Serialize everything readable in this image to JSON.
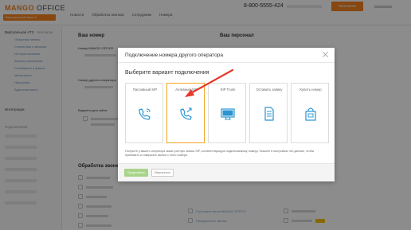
{
  "app": {
    "logo_brand": "MANGO",
    "logo_suffix": " OFFICE",
    "account": "Виртуальный офис ▾",
    "nav": [
      "Новости",
      "Обработка звонков",
      "Сотрудники",
      "Номера"
    ],
    "phone": "8-800-5555-424",
    "pay_label": "Пополнить"
  },
  "sidebar": {
    "section_main": "Виртуальная АТС",
    "section_main_secondary": "Контакты",
    "sub_items": [
      "Обзорная панель",
      "Статистика и звонков",
      "История вызовов",
      "Записи разговоров",
      "Сообщения и факсы",
      "Мониторинг",
      "Настройки",
      "Адресная книга"
    ],
    "integrations": "Интеграции",
    "connections_head": "Подключение"
  },
  "content": {
    "your_number": "Ваш номер",
    "mango_office_number": "Номер MANGO OFFICE",
    "other_operator_number": "Номер другого оператора",
    "site_widget": "Виджеты для сайта",
    "your_staff": "Ваш персонал",
    "call_processing": "Обработка звонков",
    "mango_office_voice": "Голосовое меню MANGO OFFICE",
    "holiday_routing": "Праздничные звонки"
  },
  "modal": {
    "title": "Подключение номера другого оператора",
    "subtitle": "Выберите вариант подключения",
    "options": [
      {
        "label": "Пассивный SIP",
        "icon": "phone-sip-icon"
      },
      {
        "label": "Активный SIP",
        "icon": "phone-active-sip-icon"
      },
      {
        "label": "SIP Trunk",
        "icon": "monitor-icon"
      },
      {
        "label": "Оставить заявку",
        "icon": "document-icon"
      },
      {
        "label": "Купить номер",
        "icon": "shopping-bag-icon"
      }
    ],
    "selected_index": 1,
    "footnote": "Получите у вашего оператора связи учетную запись SIP, соответствующую подключаемому номеру. Укажите в настройках эти данные, чтобы принимать и совершать звонки с этого номера.",
    "continue_label": "Продолжить",
    "back_label": "Вернуться"
  },
  "colors": {
    "accent": "#f58220",
    "icon_blue": "#2a95d2",
    "selected_border": "#f5a623",
    "arrow_red": "#e53a2c",
    "continue_green": "#a8d48a"
  }
}
